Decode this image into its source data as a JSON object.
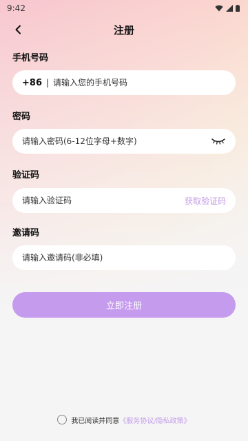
{
  "status_bar": {
    "time": "9:42"
  },
  "header": {
    "title": "注册"
  },
  "phone": {
    "label": "手机号码",
    "prefix": "+86",
    "separator": "|",
    "placeholder": "请输入您的手机号码"
  },
  "password": {
    "label": "密码",
    "placeholder": "请输入密码(6-12位字母+数字)"
  },
  "code": {
    "label": "验证码",
    "placeholder": "请输入验证码",
    "get_code": "获取验证码"
  },
  "invite": {
    "label": "邀请码",
    "placeholder": "请输入邀请码(非必填)"
  },
  "register_button": "立即注册",
  "agreement": {
    "text": "我已阅读并同意",
    "link": "《服务协议/隐私政策》"
  },
  "colors": {
    "accent": "#c59bee",
    "link": "#c39be6"
  }
}
